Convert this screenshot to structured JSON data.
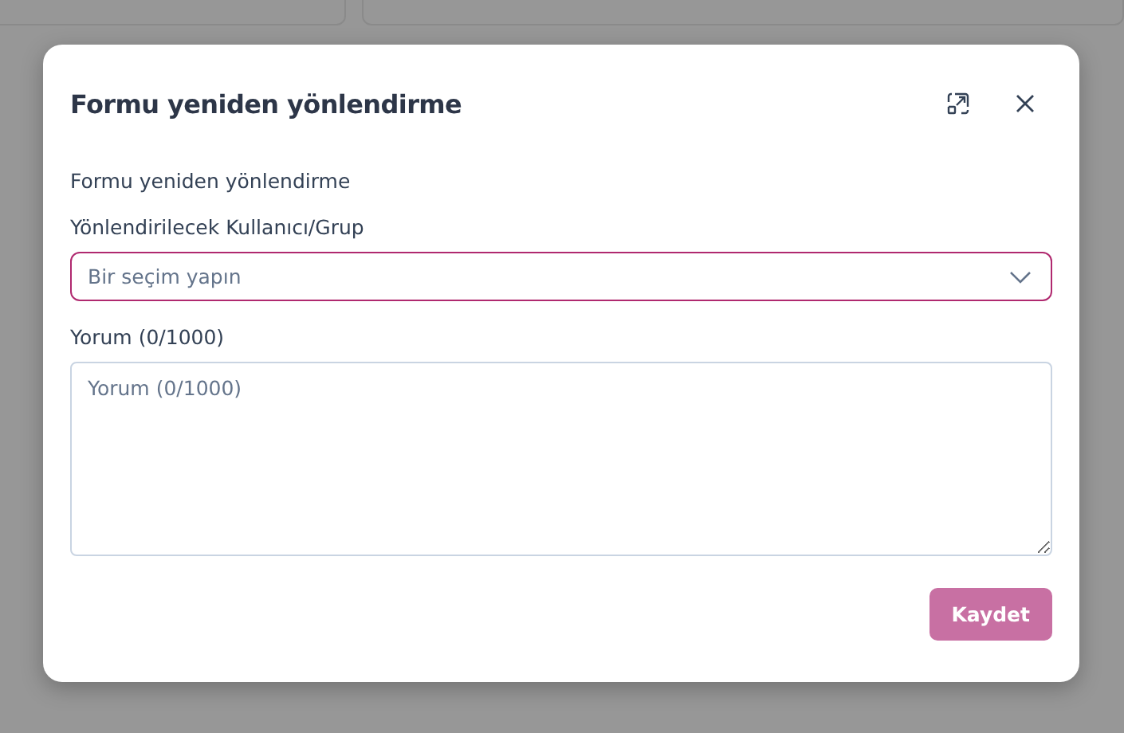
{
  "dialog": {
    "title": "Formu yeniden yönlendirme",
    "description": "Formu yeniden yönlendirme",
    "select": {
      "label": "Yönlendirilecek Kullanıcı/Grup",
      "placeholder": "Bir seçim yapın"
    },
    "comment": {
      "label": "Yorum (0/1000)",
      "placeholder": "Yorum (0/1000)"
    },
    "save_button": {
      "label": "Kaydet",
      "disabled": true
    }
  }
}
